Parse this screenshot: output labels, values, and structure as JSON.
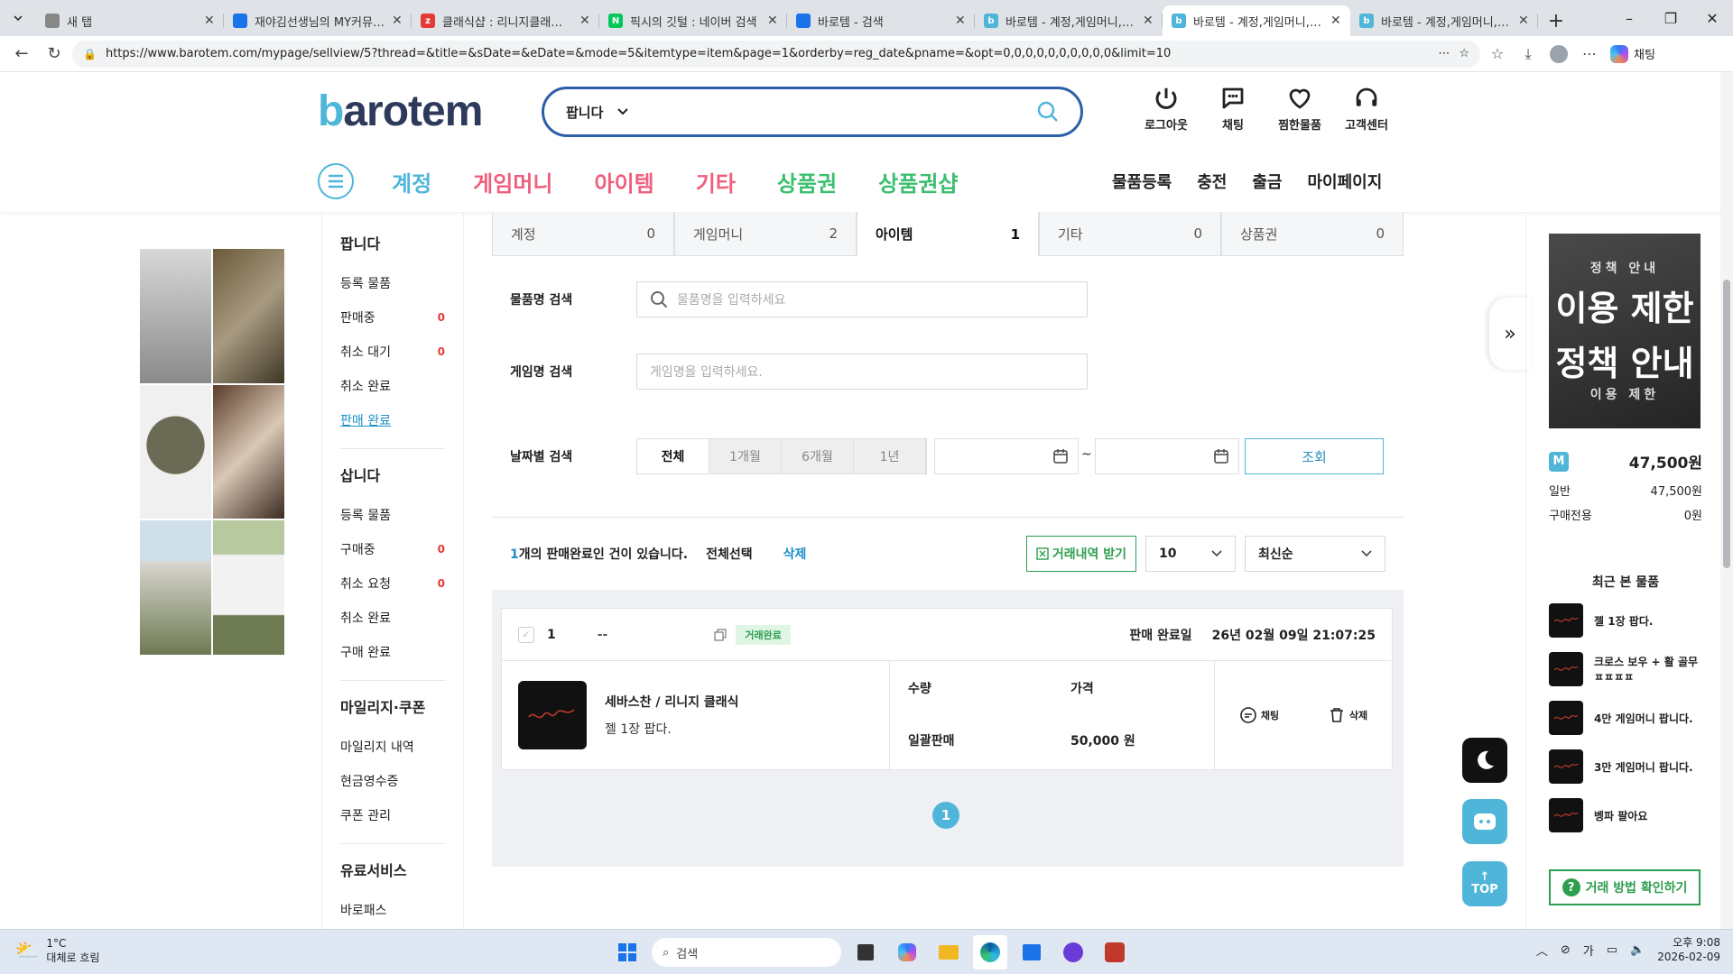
{
  "browser": {
    "tabs": [
      {
        "title": "새 탭",
        "favicon": "blank",
        "color": "#888"
      },
      {
        "title": "재야김선생님의 MY커뮤니티",
        "favicon": "community",
        "color": "#1a73e8"
      },
      {
        "title": "클래식샵 : 리니지클래식-NC",
        "favicon": "z",
        "color": "#e53935"
      },
      {
        "title": "픽시의 깃털 : 네이버 검색",
        "favicon": "N",
        "color": "#03c75a"
      },
      {
        "title": "바로템 - 검색",
        "favicon": "search",
        "color": "#1a73e8"
      },
      {
        "title": "바로템 - 계정,게임머니,아이",
        "favicon": "b",
        "color": "#4fb6d9"
      },
      {
        "title": "바로템 - 계정,게임머니,아이",
        "favicon": "b",
        "color": "#4fb6d9"
      },
      {
        "title": "바로템 - 계정,게임머니,아이",
        "favicon": "b",
        "color": "#4fb6d9"
      }
    ],
    "url": "https://www.barotem.com/mypage/sellview/5?thread=&title=&sDate=&eDate=&mode=5&itemtype=item&page=1&orderby=reg_date&pname=&opt=0,0,0,0,0,0,0,0,0,0&limit=10",
    "chat_label": "채팅"
  },
  "header": {
    "logo_b": "b",
    "logo_rest": "arotem",
    "search_select": "팝니다",
    "top_icons": [
      {
        "label": "로그아웃",
        "icon": "power-icon"
      },
      {
        "label": "채팅",
        "icon": "chat-icon"
      },
      {
        "label": "찜한물품",
        "icon": "heart-icon"
      },
      {
        "label": "고객센터",
        "icon": "headset-icon"
      }
    ],
    "categories": [
      {
        "label": "계정",
        "color": "#4fb6d9"
      },
      {
        "label": "게임머니",
        "color": "#ef5f7d"
      },
      {
        "label": "아이템",
        "color": "#ef5f7d"
      },
      {
        "label": "기타",
        "color": "#ef5f7d"
      },
      {
        "label": "상품권",
        "color": "#3bbf6e"
      },
      {
        "label": "상품권샵",
        "color": "#3bbf6e"
      }
    ],
    "subnav": [
      "물품등록",
      "충전",
      "출금",
      "마이페이지"
    ]
  },
  "sidemenu": {
    "sell_title": "팝니다",
    "sell_items": [
      {
        "label": "등록 물품",
        "count": ""
      },
      {
        "label": "판매중",
        "count": "0"
      },
      {
        "label": "취소 대기",
        "count": "0"
      },
      {
        "label": "취소 완료",
        "count": ""
      },
      {
        "label": "판매 완료",
        "count": ""
      }
    ],
    "buy_title": "삽니다",
    "buy_items": [
      {
        "label": "등록 물품",
        "count": ""
      },
      {
        "label": "구매중",
        "count": "0"
      },
      {
        "label": "취소 요청",
        "count": "0"
      },
      {
        "label": "취소 완료",
        "count": ""
      },
      {
        "label": "구매 완료",
        "count": ""
      }
    ],
    "mileage_title": "마일리지·쿠폰",
    "mileage_items": [
      "마일리지 내역",
      "현금영수증",
      "쿠폰 관리"
    ],
    "paid_title": "유료서비스",
    "paid_items": [
      "바로패스"
    ]
  },
  "main": {
    "tabs": [
      {
        "label": "계정",
        "count": "0"
      },
      {
        "label": "게임머니",
        "count": "2"
      },
      {
        "label": "아이템",
        "count": "1"
      },
      {
        "label": "기타",
        "count": "0"
      },
      {
        "label": "상품권",
        "count": "0"
      }
    ],
    "filters": {
      "item_label": "물품명 검색",
      "item_placeholder": "물품명을 입력하세요",
      "game_label": "게임명 검색",
      "game_placeholder": "게임명을 입력하세요.",
      "date_label": "날짜별 검색",
      "periods": [
        "전체",
        "1개월",
        "6개월",
        "1년"
      ],
      "tilde": "~",
      "query_label": "조회"
    },
    "result": {
      "count": "1",
      "suffix": "개의 판매완료인 건이 있습니다.",
      "select_all": "전체선택",
      "delete": "삭제",
      "export": "거래내역 받기",
      "limit": "10",
      "sort": "최신순"
    },
    "order": {
      "index": "1",
      "dash": "--",
      "status": "거래완료",
      "date_label": "판매 완료일",
      "date": "26년 02월 09일 21:07:25",
      "game": "세바스찬 / 리니지 클래식",
      "title": "젤 1장 팝다.",
      "qty_label": "수량",
      "qty_value": "일괄판매",
      "price_label": "가격",
      "price_value": "50,000 원",
      "chat": "채팅",
      "delete": "삭제"
    },
    "page": "1"
  },
  "rightbar": {
    "ad_line1": "정책 안내",
    "ad_line2": "이용 제한",
    "ad_line3": "정책 안내",
    "ad_line4": "이용 제한",
    "money_total": "47,500원",
    "general_label": "일반",
    "general_value": "47,500원",
    "purchase_label": "구매전용",
    "purchase_value": "0원",
    "recent_title": "최근 본 물품",
    "recent": [
      "젤 1장 팝다.",
      "크로스 보우 + 활 골무 ㅍㅍㅍㅍ",
      "4만 게임머니 팝니다.",
      "3만 게임머니 팝니다.",
      "벵파 팔아요"
    ],
    "howto": "거래 방법 확인하기",
    "top": "TOP"
  },
  "taskbar": {
    "temp": "1°C",
    "weather": "대체로 흐림",
    "search": "검색",
    "ime": "가",
    "time": "오후 9:08",
    "date": "2026-02-09"
  }
}
